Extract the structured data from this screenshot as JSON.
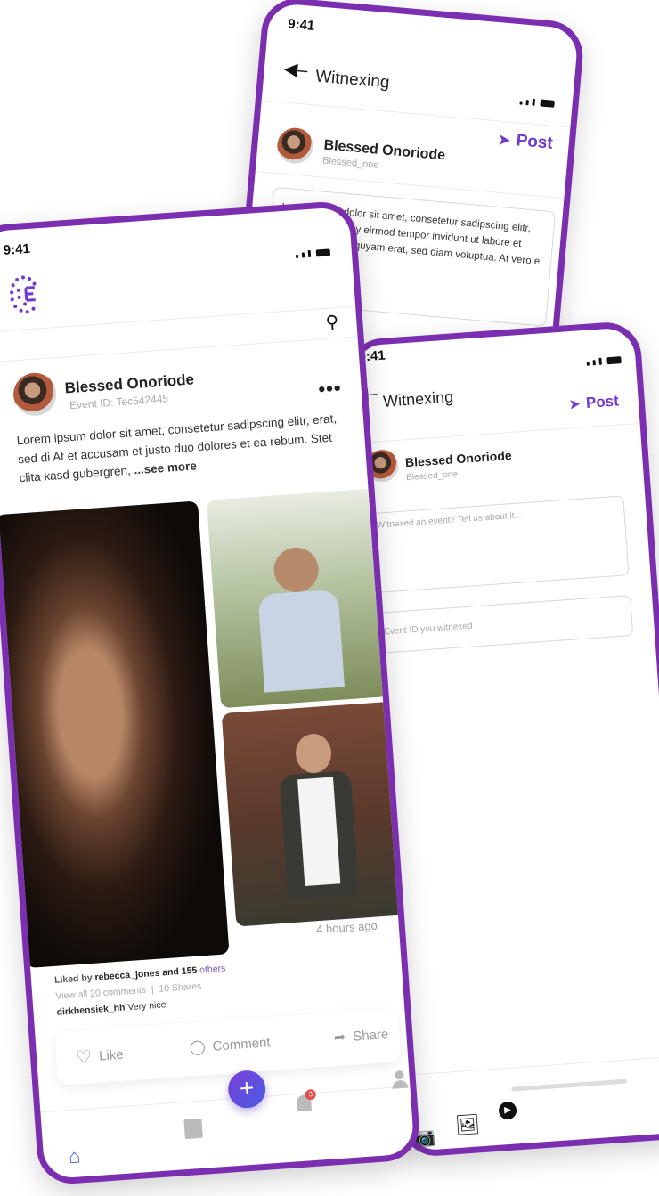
{
  "colors": {
    "accent": "#7b2fb0",
    "brand": "#6f3ad0"
  },
  "back_phone": {
    "time": "9:41",
    "title": "Witnexing",
    "post_label": "Post",
    "user": {
      "name": "Blessed Onoriode",
      "handle": "Blessed_one"
    },
    "text": "Lorem ipsum dolor sit amet, consetetur sadipscing elitr, sed diam nonumy eirmod tempor invidunt ut labore et dolore magna aliquyam erat, sed diam voluptua. At vero e"
  },
  "right_phone": {
    "time": "9:41",
    "title": "Witnexing",
    "post_label": "Post",
    "user": {
      "name": "Blessed Onoriode",
      "handle": "Blessed_one"
    },
    "event_placeholder": "Witnexed an event? Tell us about it...",
    "event_id_placeholder": "Event ID you witnexed",
    "media_icons": [
      "camera-icon",
      "gallery-icon",
      "video-icon"
    ]
  },
  "front_phone": {
    "time": "9:41",
    "post": {
      "user": {
        "name": "Blessed Onoriode",
        "event_id": "Event ID: Tec542445"
      },
      "text": "Lorem ipsum dolor sit amet, consetetur sadipscing elitr, erat, sed di At  et accusam et justo duo dolores et ea rebum. Stet clita kasd gubergren, ",
      "see_more": "...see more",
      "time_ago": "4  hours ago",
      "liked_by_prefix": "Liked by",
      "liked_by_user": "rebecca_jones and 155",
      "liked_by_others": "others",
      "view_comments": "View all 20 comments",
      "shares": "10 Shares",
      "comment_user": "dirkhensiek_hh",
      "comment_text": "Very nice"
    },
    "actions": {
      "like": "Like",
      "comment": "Comment",
      "share": "Share"
    },
    "nav": {
      "notification_count": "3"
    }
  }
}
